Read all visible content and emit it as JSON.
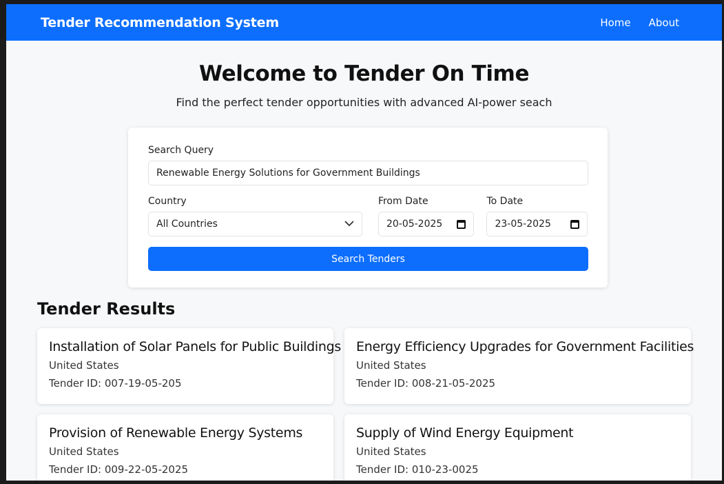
{
  "nav": {
    "brand": "Tender Recommendation System",
    "links": [
      "Home",
      "About"
    ]
  },
  "hero": {
    "title": "Welcome to Tender On Time",
    "subtitle": "Find the perfect tender opportunities with advanced AI-power seach"
  },
  "search": {
    "query_label": "Search Query",
    "query_value": "Renewable Energy Solutions for Government Buildings",
    "country_label": "Country",
    "country_value": "All Countries",
    "from_label": "From Date",
    "from_value": "20-05-2025",
    "to_label": "To Date",
    "to_value": "23-05-2025",
    "button_label": "Search Tenders"
  },
  "results": {
    "title": "Tender Results",
    "items": [
      {
        "title": "Installation of Solar Panels for Public Buildings",
        "country": "United States",
        "tender_id": "Tender ID: 007-19-05-205"
      },
      {
        "title": "Energy Efficiency Upgrades for Government Facilities",
        "country": "United States",
        "tender_id": "Tender ID: 008-21-05-2025"
      },
      {
        "title": "Provision of Renewable Energy Systems",
        "country": "United States",
        "tender_id": "Tender ID: 009-22-05-2025"
      },
      {
        "title": "Supply of Wind Energy Equipment",
        "country": "United States",
        "tender_id": "Tender ID: 010-23-0025"
      }
    ]
  },
  "colors": {
    "primary": "#0d6efd",
    "background": "#f7f8fa"
  },
  "icons": {
    "dropdown": "chevron-down-icon",
    "date": "calendar-icon"
  }
}
